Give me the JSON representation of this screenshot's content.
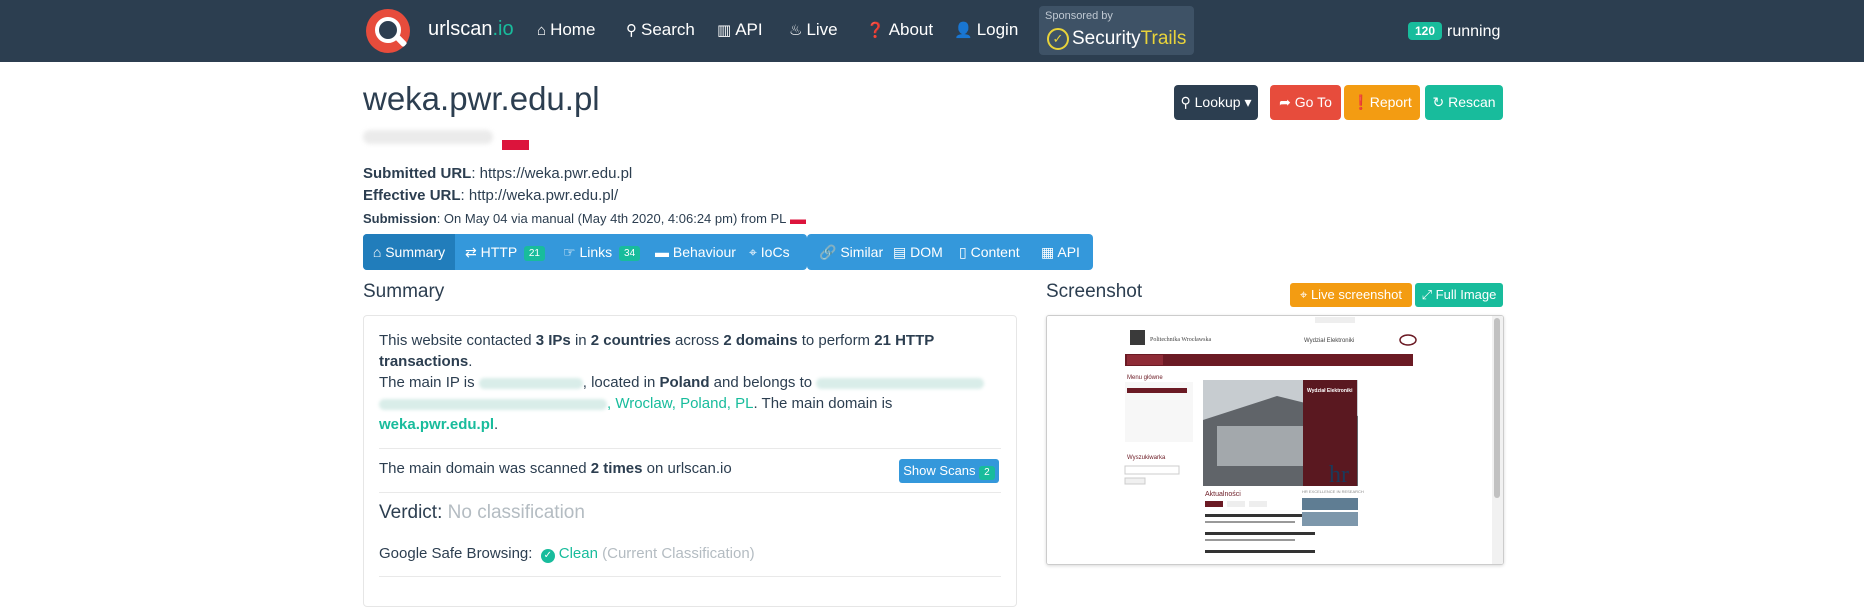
{
  "nav": {
    "brand_main": "urlscan",
    "brand_tld": ".io",
    "items": [
      "Home",
      "Search",
      "API",
      "Live",
      "About",
      "Login"
    ],
    "sponsor_label": "Sponsored by",
    "sponsor_name_a": "Security",
    "sponsor_name_b": "Trails",
    "running_count": "120",
    "running_label": "running"
  },
  "header": {
    "domain": "weka.pwr.edu.pl",
    "submitted_label": "Submitted URL",
    "submitted_value": ": https://weka.pwr.edu.pl",
    "effective_label": "Effective URL",
    "effective_value": ": http://weka.pwr.edu.pl/",
    "submission_label": "Submission",
    "submission_value": ": On May 04 via manual (May 4th 2020, 4:06:24 pm) from PL"
  },
  "actions": {
    "lookup": "Lookup",
    "goto": "Go To",
    "report": "Report",
    "rescan": "Rescan"
  },
  "tabs": {
    "summary": "Summary",
    "http": "HTTP",
    "http_count": "21",
    "links": "Links",
    "links_count": "34",
    "behaviour": "Behaviour",
    "iocs": "IoCs",
    "similar": "Similar",
    "dom": "DOM",
    "content": "Content",
    "api": "API"
  },
  "summary": {
    "title": "Summary",
    "s1a": "This website contacted ",
    "s1b": "3 IPs",
    "s1c": " in ",
    "s1d": "2 countries",
    "s1e": " across ",
    "s1f": "2 domains",
    "s1g": " to perform ",
    "s1h": "21 HTTP",
    "s1i": "transactions",
    "s1j": ".",
    "s2a": "The main IP is ",
    "s2b": ", located in ",
    "s2c": "Poland",
    "s2d": " and belongs to ",
    "s2e": ", Wroclaw, Poland, PL",
    "s2f": ". The main domain is",
    "main_domain": "weka.pwr.edu.pl",
    "main_domain_end": ".",
    "scan_a": "The main domain was scanned ",
    "scan_b": "2 times",
    "scan_c": " on urlscan.io",
    "show_scans": "Show Scans",
    "show_scans_count": "2",
    "verdict_label": "Verdict:",
    "verdict_value": "No classification",
    "gsb_label": "Google Safe Browsing:",
    "gsb_value": "Clean",
    "gsb_note": "(Current Classification)"
  },
  "screenshot": {
    "title": "Screenshot",
    "live": "Live screenshot",
    "full": "Full Image",
    "site_name": "Politechnika Wrocławska",
    "dept_name": "Wydział Elektroniki",
    "hero_title": "Wydział Elektroniki",
    "menu_title": "Menu główne",
    "search_title": "Wyszukiwarka",
    "news_title": "Aktualności",
    "hr_text": "HR EXCELLENCE IN RESEARCH"
  },
  "colors": {
    "navbar": "#2c3e50",
    "primary": "#3498db",
    "success": "#18bc9c",
    "danger": "#e74c3c",
    "warning": "#f39c12"
  }
}
